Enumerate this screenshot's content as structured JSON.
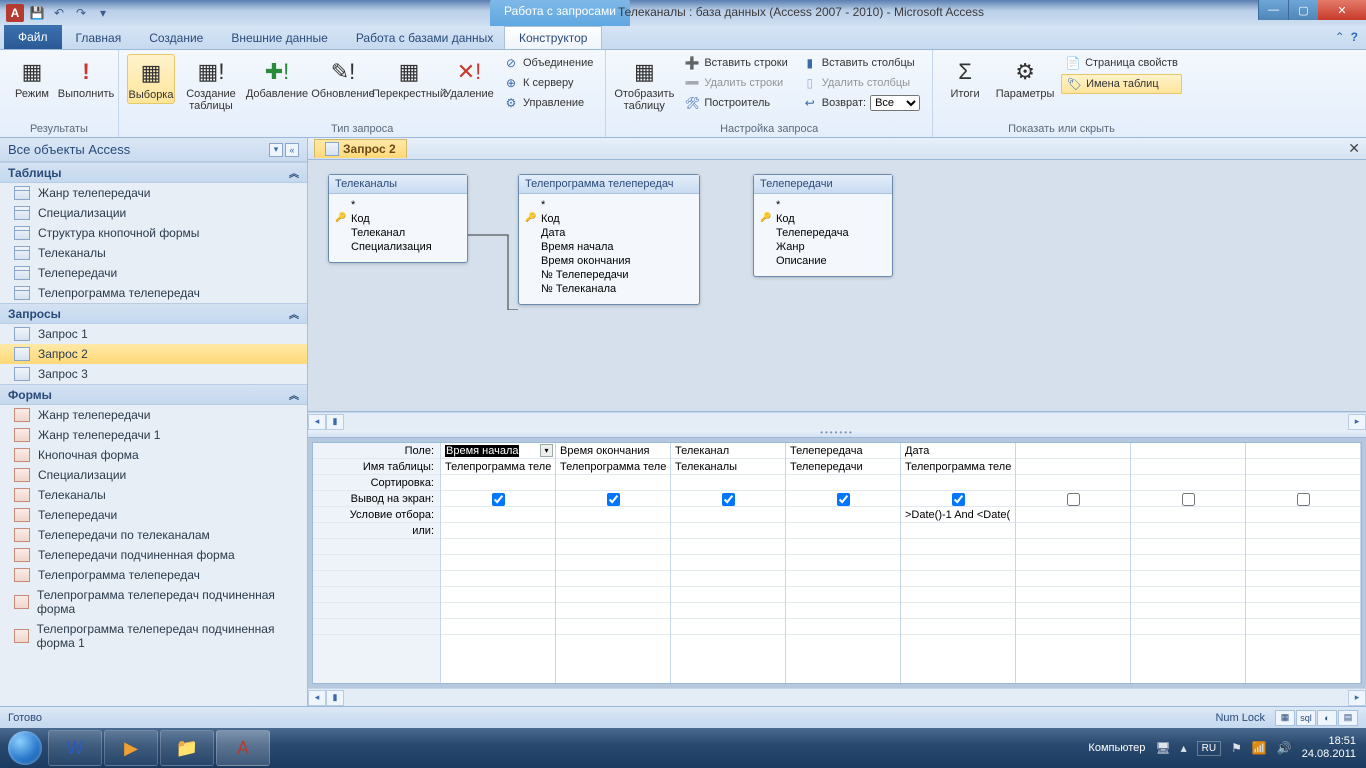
{
  "titlebar": {
    "contextual_title": "Работа с запросами",
    "window_title": "Телеканалы : база данных (Access 2007 - 2010)  -  Microsoft Access",
    "app_letter": "A"
  },
  "tabs": {
    "file": "Файл",
    "home": "Главная",
    "create": "Создание",
    "external": "Внешние данные",
    "dbtools": "Работа с базами данных",
    "design": "Конструктор"
  },
  "ribbon": {
    "results": {
      "view": "Режим",
      "run": "Выполнить",
      "group": "Результаты"
    },
    "querytype": {
      "select": "Выборка",
      "maketable": "Создание таблицы",
      "append": "Добавление",
      "update": "Обновление",
      "crosstab": "Перекрестный",
      "delete": "Удаление",
      "union": "Объединение",
      "passthrough": "К серверу",
      "datadef": "Управление",
      "group": "Тип запроса"
    },
    "showtable": {
      "btn": "Отобразить таблицу",
      "group": "Настройка запроса",
      "insrows": "Вставить строки",
      "delrows": "Удалить строки",
      "builder": "Построитель",
      "inscols": "Вставить столбцы",
      "delcols": "Удалить столбцы",
      "return": "Возврат:",
      "return_val": "Все"
    },
    "showhide": {
      "totals": "Итоги",
      "params": "Параметры",
      "propsheet": "Страница свойств",
      "tablenames": "Имена таблиц",
      "group": "Показать или скрыть"
    }
  },
  "nav": {
    "header": "Все объекты Access",
    "sec_tables": "Таблицы",
    "tables": [
      "Жанр телепередачи",
      "Специализации",
      "Структура кнопочной формы",
      "Телеканалы",
      "Телепередачи",
      "Телепрограмма телепередач"
    ],
    "sec_queries": "Запросы",
    "queries": [
      "Запрос 1",
      "Запрос 2",
      "Запрос 3"
    ],
    "sec_forms": "Формы",
    "forms": [
      "Жанр телепередачи",
      "Жанр телепередачи 1",
      "Кнопочная форма",
      "Специализации",
      "Телеканалы",
      "Телепередачи",
      "Телепередачи по телеканалам",
      "Телепередачи подчиненная форма",
      "Телепрограмма телепередач",
      "Телепрограмма телепередач подчиненная форма",
      "Телепрограмма телепередач подчиненная форма 1"
    ]
  },
  "doctab": "Запрос 2",
  "diagram": {
    "t1": {
      "title": "Телеканалы",
      "star": "*",
      "f1": "Код",
      "f2": "Телеканал",
      "f3": "Специализация"
    },
    "t2": {
      "title": "Телепрограмма телепередач",
      "star": "*",
      "f1": "Код",
      "f2": "Дата",
      "f3": "Время начала",
      "f4": "Время окончания",
      "f5": "№ Телепередачи",
      "f6": "№ Телеканала"
    },
    "t3": {
      "title": "Телепередачи",
      "star": "*",
      "f1": "Код",
      "f2": "Телепередача",
      "f3": "Жанр",
      "f4": "Описание"
    }
  },
  "gridlabels": {
    "field": "Поле:",
    "table": "Имя таблицы:",
    "sort": "Сортировка:",
    "show": "Вывод на экран:",
    "criteria": "Условие отбора:",
    "or": "или:"
  },
  "cols": [
    {
      "field": "Время начала",
      "table": "Телепрограмма теле",
      "show": true,
      "criteria": "",
      "active": true
    },
    {
      "field": "Время окончания",
      "table": "Телепрограмма теле",
      "show": true,
      "criteria": ""
    },
    {
      "field": "Телеканал",
      "table": "Телеканалы",
      "show": true,
      "criteria": ""
    },
    {
      "field": "Телепередача",
      "table": "Телепередачи",
      "show": true,
      "criteria": ""
    },
    {
      "field": "Дата",
      "table": "Телепрограмма теле",
      "show": true,
      "criteria": ">Date()-1 And <Date("
    },
    {
      "field": "",
      "table": "",
      "show": false,
      "criteria": ""
    },
    {
      "field": "",
      "table": "",
      "show": false,
      "criteria": ""
    },
    {
      "field": "",
      "table": "",
      "show": false,
      "criteria": ""
    }
  ],
  "status": {
    "ready": "Готово",
    "numlock": "Num Lock"
  },
  "taskbar": {
    "computer": "Компьютер",
    "lang": "RU",
    "time": "18:51",
    "date": "24.08.2011"
  }
}
